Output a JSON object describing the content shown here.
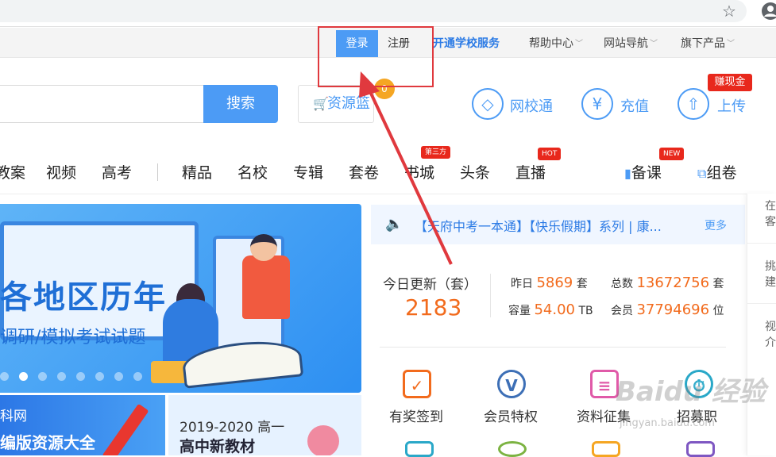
{
  "browser": {
    "star_icon": "star-icon",
    "profile_icon": "profile-icon"
  },
  "topnav": {
    "login": "登录",
    "register": "注册",
    "school_service": "开通学校服务",
    "help": "帮助中心",
    "site_nav": "网站导航",
    "products": "旗下产品"
  },
  "search": {
    "button": "搜索",
    "basket": "资源篮",
    "basket_count": "0"
  },
  "quick_links": [
    {
      "label": "网校通",
      "icon": "diamond-icon"
    },
    {
      "label": "充值",
      "icon": "yen-icon"
    },
    {
      "label": "上传",
      "icon": "upload-icon"
    }
  ],
  "earn_badge": "赚现金",
  "categories": {
    "items": [
      "教案",
      "视频",
      "高考",
      "精品",
      "名校",
      "专辑",
      "套卷",
      "书城",
      "头条",
      "直播"
    ],
    "badge_third": "第三方",
    "badge_hot": "HOT",
    "badge_new": "NEW",
    "prepare": "备课",
    "compose": "组卷"
  },
  "banner": {
    "title": "各地区历年",
    "subtitle": "调研/模拟考试试题",
    "dots_total": 8,
    "dots_active_index": 1
  },
  "sub_banners": {
    "left_line1": "科网",
    "left_line2": "编版资源大全",
    "right_line1": "2019-2020 高一",
    "right_line2": "高中新教材"
  },
  "notice": {
    "text": "【天府中考一本通】【快乐假期】系列 | 康...",
    "more": "更多"
  },
  "stats": {
    "today_label": "今日更新（套）",
    "today_value": "2183",
    "yesterday_label": "昨日",
    "yesterday_value": "5869",
    "yesterday_unit": "套",
    "total_label": "总数",
    "total_value": "13672756",
    "total_unit": "套",
    "capacity_label": "容量",
    "capacity_value": "54.00",
    "capacity_unit": "TB",
    "members_label": "会员",
    "members_value": "37794696",
    "members_unit": "位"
  },
  "features": [
    {
      "label": "有奖签到",
      "icon": "checkin-icon",
      "color": "#f26b1d"
    },
    {
      "label": "会员特权",
      "icon": "vip-icon",
      "color": "#3d6fb6"
    },
    {
      "label": "资料征集",
      "icon": "collect-icon",
      "color": "#e05aa8"
    },
    {
      "label": "招募职",
      "icon": "recruit-icon",
      "color": "#2aa8c8"
    }
  ],
  "side_panel": {
    "item1": "在客",
    "item2": "挑建",
    "item3": "视介"
  },
  "watermark": {
    "brand": "Baidu 经验",
    "url": "jingyan.baidu.com"
  },
  "colors": {
    "primary": "#4c9bf5",
    "accent": "#f26b1d",
    "annotation": "#e0393e"
  }
}
